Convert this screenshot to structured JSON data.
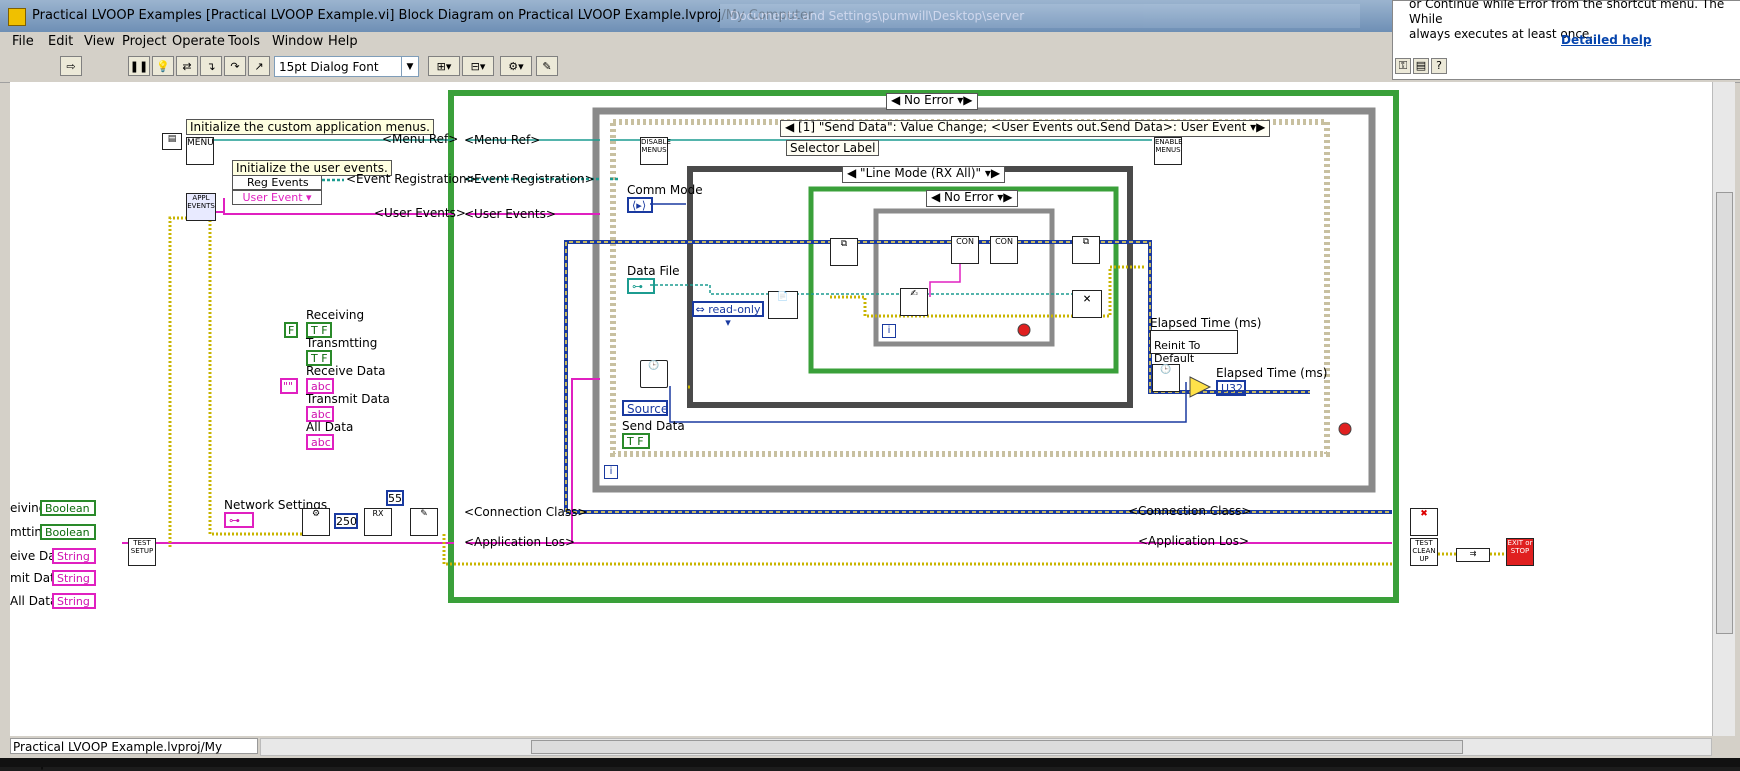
{
  "window": {
    "title": "Practical LVOOP  Examples [Practical LVOOP Example.vi] Block Diagram on Practical LVOOP Example.lvproj/My Computer",
    "glass_text": "Documents and Settings\\pumwill\\Desktop\\server"
  },
  "menu": [
    "File",
    "Edit",
    "View",
    "Project",
    "Operate",
    "Tools",
    "Window",
    "Help"
  ],
  "toolbar": {
    "font": "15pt Dialog Font"
  },
  "help": {
    "line1": "or Continue while Error from the shortcut menu. The While",
    "line2": "always executes at least once.",
    "link": "Detailed help"
  },
  "status": {
    "path": "Practical LVOOP Example.lvproj/My Computer"
  },
  "diagram": {
    "comments": [
      "Initialize the custom application menus.",
      "Initialize the user events."
    ],
    "tunnels": {
      "menu_ref": "<Menu Ref>",
      "event_reg": "<Event Registration>",
      "user_events": "<User Events>",
      "connection": "<Connection Class>",
      "app_log": "<Application Los>"
    },
    "reg_events": "Reg Events",
    "user_event": "User Event",
    "appl_events": "APPL EVENTS",
    "controls_left": [
      "Receiving",
      "Transmtting",
      "Receive Data",
      "Transmit Data",
      "All Data"
    ],
    "terms_left": [
      {
        "label": "eiving",
        "type": "Boolean"
      },
      {
        "label": "mtting",
        "type": "Boolean"
      },
      {
        "label": "eive Data",
        "type": "String"
      },
      {
        "label": "mit Data",
        "type": "String"
      },
      {
        "label": "All Data",
        "type": "String"
      }
    ],
    "network_settings": "Network Settings",
    "const_250": "250",
    "const_55": "55",
    "test_setup": "TEST SETUP",
    "test_cleanup": "TEST CLEAN UP",
    "exit_stop": "EXIT or STOP",
    "outer_case": "No Error",
    "event_case": "[1] \"Send Data\": Value Change;  <User Events out.Send Data>: User Event",
    "selector_label": "Selector Label",
    "disable_menus": "DISABLE MENUS",
    "enable_menus": "ENABLE MENUS",
    "comm_mode": "Comm Mode",
    "data_file": "Data File",
    "line_mode_case": "\"Line Mode (RX All)\"",
    "inner_case": "No Error",
    "read_only": "read-only",
    "elapsed1": "Elapsed Time (ms)",
    "reinit": "Reinit To Default",
    "elapsed2": "Elapsed Time (ms)",
    "u32": "U32",
    "source": "Source",
    "send_data": "Send Data",
    "iter": "i"
  }
}
